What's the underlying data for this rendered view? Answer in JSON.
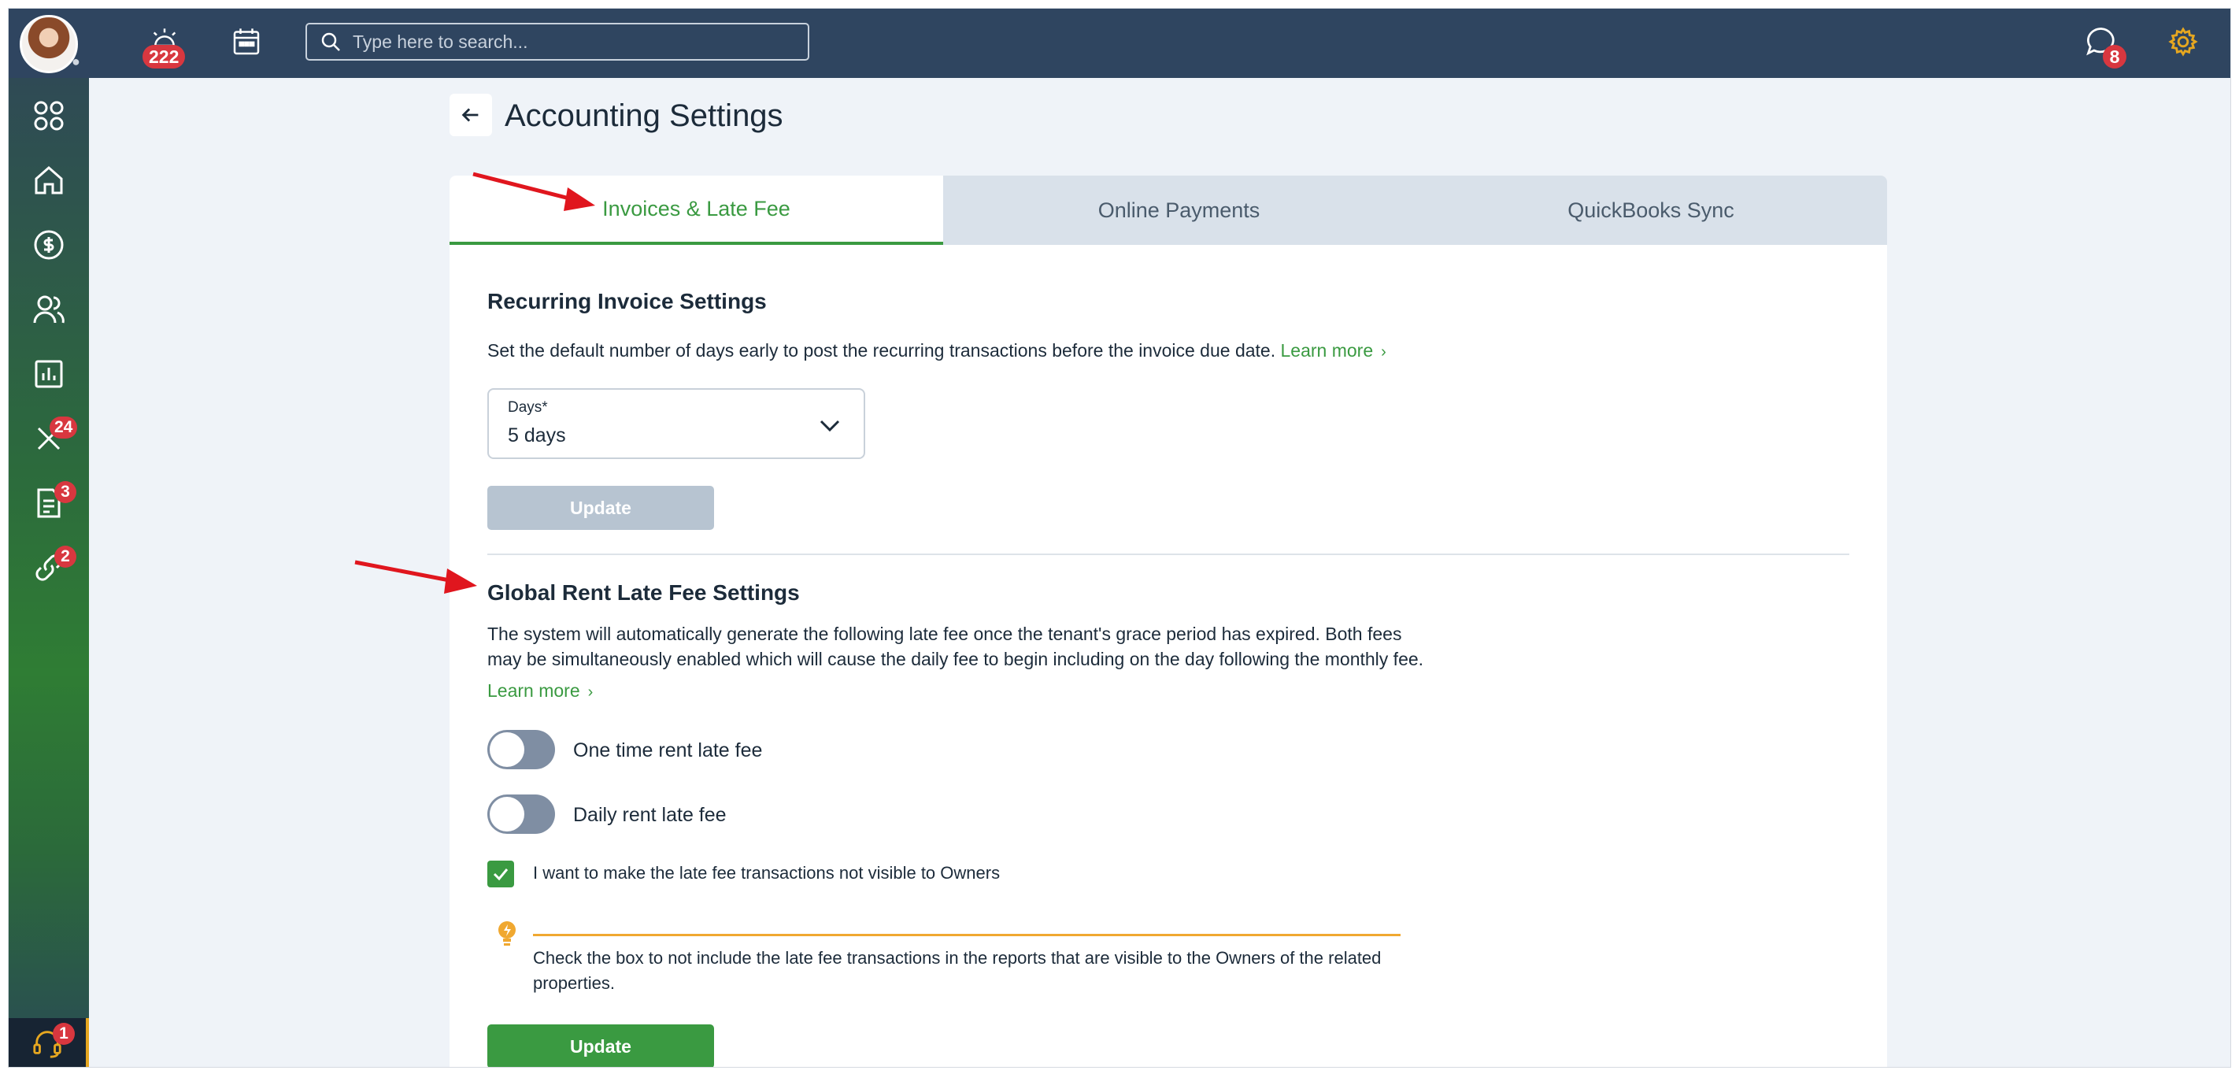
{
  "topbar": {
    "alerts_badge": "222",
    "search_placeholder": "Type here to search...",
    "messages_badge": "8"
  },
  "sidebar": {
    "items": [
      {
        "icon": "apps-grid-icon"
      },
      {
        "icon": "home-icon"
      },
      {
        "icon": "dollar-icon"
      },
      {
        "icon": "people-icon"
      },
      {
        "icon": "chart-icon"
      },
      {
        "icon": "tools-icon",
        "badge": "24"
      },
      {
        "icon": "document-icon",
        "badge": "3"
      },
      {
        "icon": "link-icon",
        "badge": "2"
      }
    ],
    "help_badge": "1"
  },
  "page": {
    "title": "Accounting Settings"
  },
  "tabs": [
    {
      "label": "Invoices & Late Fee",
      "active": true
    },
    {
      "label": "Online Payments",
      "active": false
    },
    {
      "label": "QuickBooks Sync",
      "active": false
    }
  ],
  "recurring": {
    "title": "Recurring Invoice Settings",
    "description": "Set the default number of days early to post the recurring transactions before the invoice due date.",
    "learn_more": "Learn more",
    "select_label": "Days*",
    "select_value": "5 days",
    "update_label": "Update"
  },
  "late_fee": {
    "title": "Global Rent Late Fee Settings",
    "description_1": "The system will automatically generate the following late fee once the tenant's grace period has expired. Both fees",
    "description_2": "may be simultaneously enabled which will cause the daily fee to begin including on the day following the monthly fee.",
    "learn_more": "Learn more",
    "toggle_one_time": "One time rent late fee",
    "toggle_daily": "Daily rent late fee",
    "checkbox_label": "I want to make the late fee transactions not visible to Owners",
    "checkbox_checked": true,
    "hint_text": "Check the box to not include the late fee transactions in the reports that are visible to the Owners of the related properties.",
    "update_label": "Update"
  },
  "colors": {
    "topbar": "#2f4560",
    "accent_green": "#3a9a41",
    "badge_red": "#d8373f",
    "hint_orange": "#f0a830",
    "annotation_arrow": "#e0161e"
  }
}
